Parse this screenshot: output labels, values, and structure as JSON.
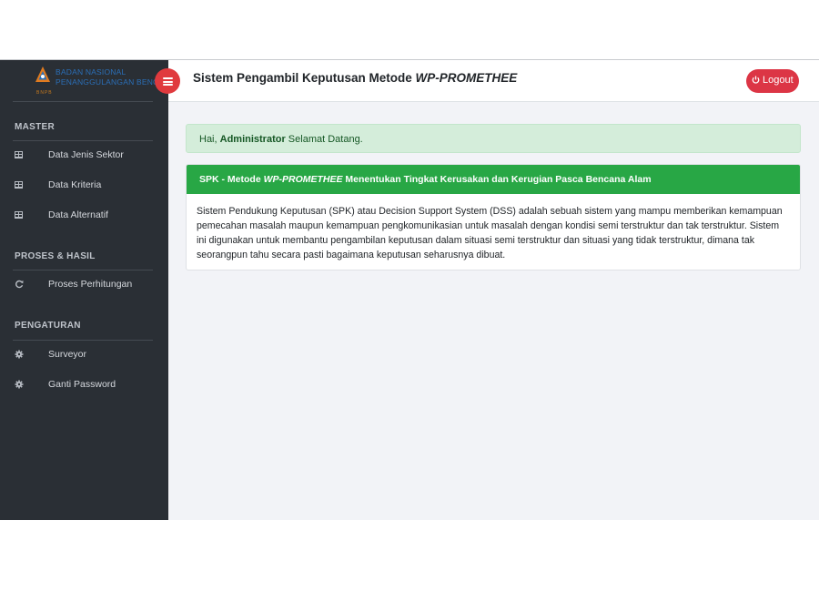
{
  "sidebar": {
    "logo": {
      "line1": "BADAN NASIONAL",
      "line2": "PENANGGULANGAN BENCANA",
      "sub": "BNPB"
    },
    "sections": [
      {
        "title": "MASTER",
        "items": [
          {
            "label": "Data Jenis Sektor",
            "icon": "table-icon"
          },
          {
            "label": "Data Kriteria",
            "icon": "table-icon"
          },
          {
            "label": "Data Alternatif",
            "icon": "table-icon"
          }
        ]
      },
      {
        "title": "PROSES & HASIL",
        "items": [
          {
            "label": "Proses Perhitungan",
            "icon": "refresh-icon"
          }
        ]
      },
      {
        "title": "PENGATURAN",
        "items": [
          {
            "label": "Surveyor",
            "icon": "gear-icon"
          },
          {
            "label": "Ganti Password",
            "icon": "gear-icon"
          }
        ]
      }
    ]
  },
  "topbar": {
    "title_prefix": "Sistem Pengambil Keputusan Metode ",
    "title_method": "WP-PROMETHEE",
    "logout_label": "Logout"
  },
  "alert": {
    "greeting": "Hai, ",
    "user": "Administrator",
    "message": " Selamat Datang."
  },
  "card": {
    "title_prefix": "SPK - Metode ",
    "title_method": "WP-PROMETHEE",
    "title_suffix": " Menentukan Tingkat Kerusakan dan Kerugian Pasca Bencana Alam",
    "body": "Sistem Pendukung Keputusan (SPK) atau Decision Support System (DSS) adalah sebuah sistem yang mampu memberikan kemampuan pemecahan masalah maupun kemampuan pengkomunikasian untuk masalah dengan kondisi semi terstruktur dan tak terstruktur. Sistem ini digunakan untuk membantu pengambilan keputusan dalam situasi semi terstruktur dan situasi yang tidak terstruktur, dimana tak seorangpun tahu secara pasti bagaimana keputusan seharusnya dibuat."
  },
  "colors": {
    "sidebar_bg": "#2a2f35",
    "accent_red": "#dc3545",
    "header_green": "#28a745",
    "alert_green": "#d4edda"
  }
}
